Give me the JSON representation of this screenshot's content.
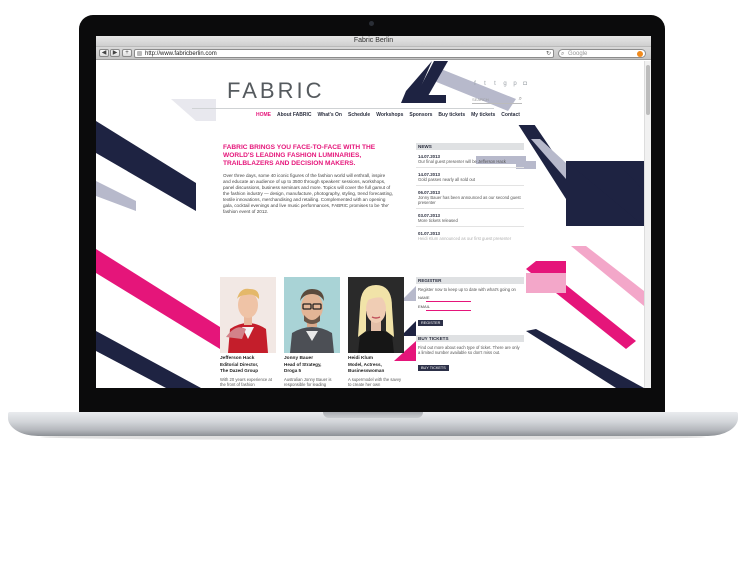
{
  "browser": {
    "window_title": "Fabric Berlin",
    "url": "http://www.fabricberlin.com",
    "search_placeholder": "Google"
  },
  "site": {
    "logo": "FABRIC",
    "social_icons": [
      "facebook-icon",
      "twitter-icon",
      "tumblr-icon",
      "google-plus-icon",
      "pinterest-icon",
      "instagram-icon"
    ],
    "search_label": "SEARCH",
    "nav": [
      "HOME",
      "About FABRIC",
      "What's On",
      "Schedule",
      "Workshops",
      "Sponsors",
      "Buy tickets",
      "My tickets",
      "Contact"
    ],
    "headline": "FABRIC BRINGS YOU FACE-TO-FACE WITH THE WORLD'S LEADING FASHION LUMINARIES, TRAILBLAZERS AND DECISION MAKERS.",
    "intro": "Over three days, some 40 iconic figures of the fashion world will enthrall, inspire and educate an audience of up to 3500 through speakers' sessions, workshops, panel discussions, business seminars and more. Topics will cover the full gamut of the fashion industry — design, manufacture, photography, styling, trend forecasting, textile innovations, merchandising and retailing. Complemented with an opening gala, cocktail evenings and live music performances, FABRIC promises to be 'the' fashion event of 2012.",
    "news_heading": "NEWS",
    "news": [
      {
        "date": "14.07.2013",
        "text": "Our final guest presenter will be Jefferson Hack"
      },
      {
        "date": "14.07.2013",
        "text": "Gold passes nearly all sold out"
      },
      {
        "date": "06.07.2013",
        "text": "Jonny Bauer has been announced as our second guest presenter"
      },
      {
        "date": "03.07.2013",
        "text": "More tickets released"
      },
      {
        "date": "01.07.2013",
        "text": "Heidi Klum announced as our first guest presenter"
      }
    ],
    "register": {
      "heading": "REGISTER",
      "text": "Register now to keep up to date with what's going on",
      "name_label": "NAME",
      "email_label": "EMAIL",
      "button": "REGISTER"
    },
    "buy": {
      "heading": "BUY TICKETS",
      "text": "Find out more about each type of ticket. There are only a limited number available so don't miss out.",
      "button": "BUY TICKETS"
    },
    "speakers": [
      {
        "name": "Jefferson Hack",
        "role1": "Editorial Director,",
        "role2": "The Dazed Group",
        "bio": "With 20 years experience at the front of fashion"
      },
      {
        "name": "Jonny Bauer",
        "role1": "Head of Strategy,",
        "role2": "Droga 5",
        "bio": "Australian Jonny Bauer is responsible for leading"
      },
      {
        "name": "Heidi Klum",
        "role1": "Model, Actress,",
        "role2": "Businesswoman",
        "bio": "A supermodel with the savvy to create her own"
      }
    ]
  },
  "colors": {
    "accent": "#e5157a",
    "navy": "#1e2342",
    "lavender": "#b7b9cb",
    "pink_light": "#f3a7c9"
  }
}
